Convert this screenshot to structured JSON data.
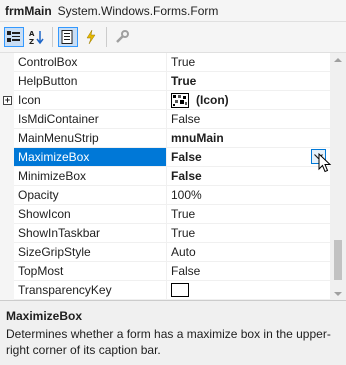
{
  "header": {
    "object_name": "frmMain",
    "object_type": "System.Windows.Forms.Form"
  },
  "toolbar": {
    "buttons": [
      {
        "icon": "categorized-icon",
        "checked": true
      },
      {
        "icon": "alphabetical-icon",
        "checked": false
      },
      {
        "icon": "properties-icon",
        "checked": true
      },
      {
        "icon": "events-icon",
        "checked": false
      },
      {
        "icon": "property-pages-icon",
        "checked": false
      }
    ]
  },
  "properties": [
    {
      "name": "ControlBox",
      "value": "True",
      "bold": false
    },
    {
      "name": "HelpButton",
      "value": "True",
      "bold": true
    },
    {
      "name": "Icon",
      "value": "(Icon)",
      "bold": true,
      "expandable": true,
      "expander": "+"
    },
    {
      "name": "IsMdiContainer",
      "value": "False",
      "bold": false
    },
    {
      "name": "MainMenuStrip",
      "value": "mnuMain",
      "bold": true
    },
    {
      "name": "MaximizeBox",
      "value": "False",
      "bold": true,
      "selected": true
    },
    {
      "name": "MinimizeBox",
      "value": "False",
      "bold": true
    },
    {
      "name": "Opacity",
      "value": "100%",
      "bold": false
    },
    {
      "name": "ShowIcon",
      "value": "True",
      "bold": false
    },
    {
      "name": "ShowInTaskbar",
      "value": "True",
      "bold": false
    },
    {
      "name": "SizeGripStyle",
      "value": "Auto",
      "bold": false
    },
    {
      "name": "TopMost",
      "value": "False",
      "bold": false
    },
    {
      "name": "TransparencyKey",
      "value": "",
      "bold": false,
      "swatch_color": "#ffffff"
    }
  ],
  "description": {
    "title": "MaximizeBox",
    "text": "Determines whether a form has a maximize box in the upper-right corner of its caption bar."
  },
  "colors": {
    "selection": "#0078d7",
    "grid_background": "#ffffff",
    "panel_background": "#f0f0f0"
  }
}
